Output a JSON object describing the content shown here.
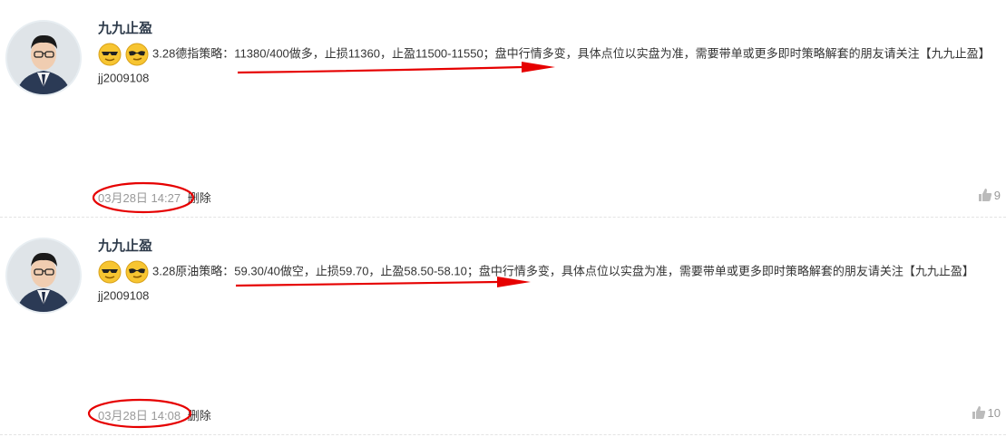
{
  "posts": [
    {
      "author": "九九止盈",
      "text": "3.28德指策略：11380/400做多，止损11360，止盈11500-11550；盘中行情多变，具体点位以实盘为准，需要带单或更多即时策略解套的朋友请关注【九九止盈】jj2009108",
      "time": "03月28日 14:27",
      "delete_label": "删除",
      "likes": "9"
    },
    {
      "author": "九九止盈",
      "text": "3.28原油策略：59.30/40做空，止损59.70，止盈58.50-58.10；盘中行情多变，具体点位以实盘为准，需要带单或更多即时策略解套的朋友请关注【九九止盈】jj2009108",
      "time": "03月28日 14:08",
      "delete_label": "删除",
      "likes": "10"
    }
  ],
  "colors": {
    "annotation": "#e60000",
    "author": "#2d3a4a",
    "meta": "#999999"
  },
  "icons": [
    "sunglasses-emoji-icon",
    "cool-emoji-icon",
    "thumbs-up-icon"
  ]
}
